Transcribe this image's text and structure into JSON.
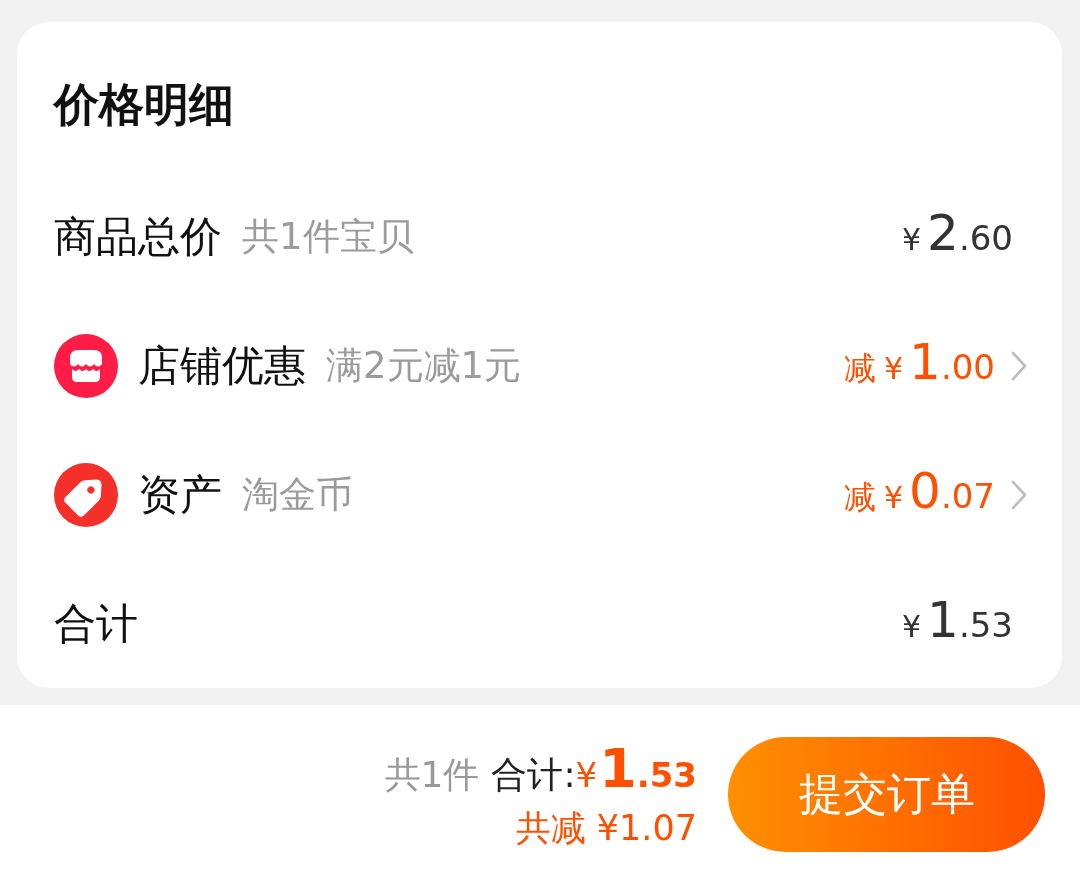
{
  "title": "价格明细",
  "rows": [
    {
      "kind": "plain",
      "label": "商品总价",
      "note": "共1件宝贝",
      "amount": {
        "currency": "¥",
        "integer": "2",
        "decimal": ".60"
      }
    },
    {
      "kind": "shop",
      "label": "店铺优惠",
      "note": "满2元减1元",
      "amount": {
        "prefix": "减",
        "currency": "¥",
        "integer": "1",
        "decimal": ".00"
      }
    },
    {
      "kind": "asset",
      "label": "资产",
      "note": "淘金币",
      "amount": {
        "prefix": "减",
        "currency": "¥",
        "integer": "0",
        "decimal": ".07"
      }
    },
    {
      "kind": "plain",
      "label": "合计",
      "amount": {
        "currency": "¥",
        "integer": "1",
        "decimal": ".53"
      }
    }
  ],
  "footer": {
    "count": "共1件",
    "total_label": "合计:",
    "total": {
      "currency": "¥",
      "integer": "1",
      "decimal": ".53"
    },
    "saved": "共减 ¥1.07",
    "submit": "提交订单"
  }
}
